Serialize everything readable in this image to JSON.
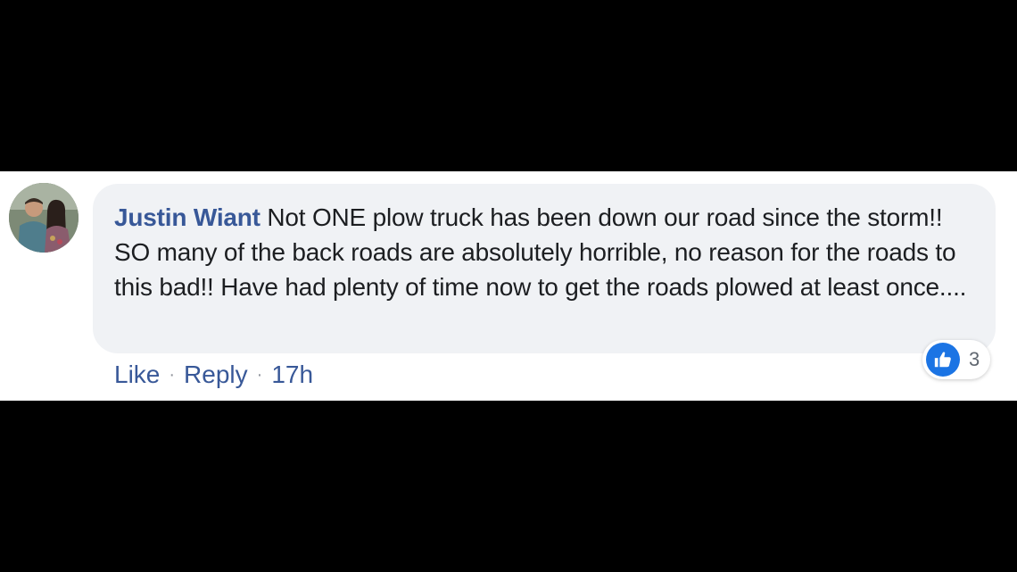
{
  "comment": {
    "author": "Justin Wiant",
    "text": "Not ONE plow truck has been down our road since the storm!! SO many of the back roads are absolutely horrible, no reason for the roads to this bad!! Have had plenty of time now to get the roads plowed at least once...."
  },
  "reactions": {
    "icon": "thumbs-up-icon",
    "count": "3",
    "color": "#1b74e4"
  },
  "actions": {
    "like_label": "Like",
    "reply_label": "Reply",
    "separator": "·",
    "timestamp": "17h"
  },
  "colors": {
    "author_link": "#385898",
    "bubble_bg": "#f0f2f5",
    "letterbox": "#000000"
  }
}
